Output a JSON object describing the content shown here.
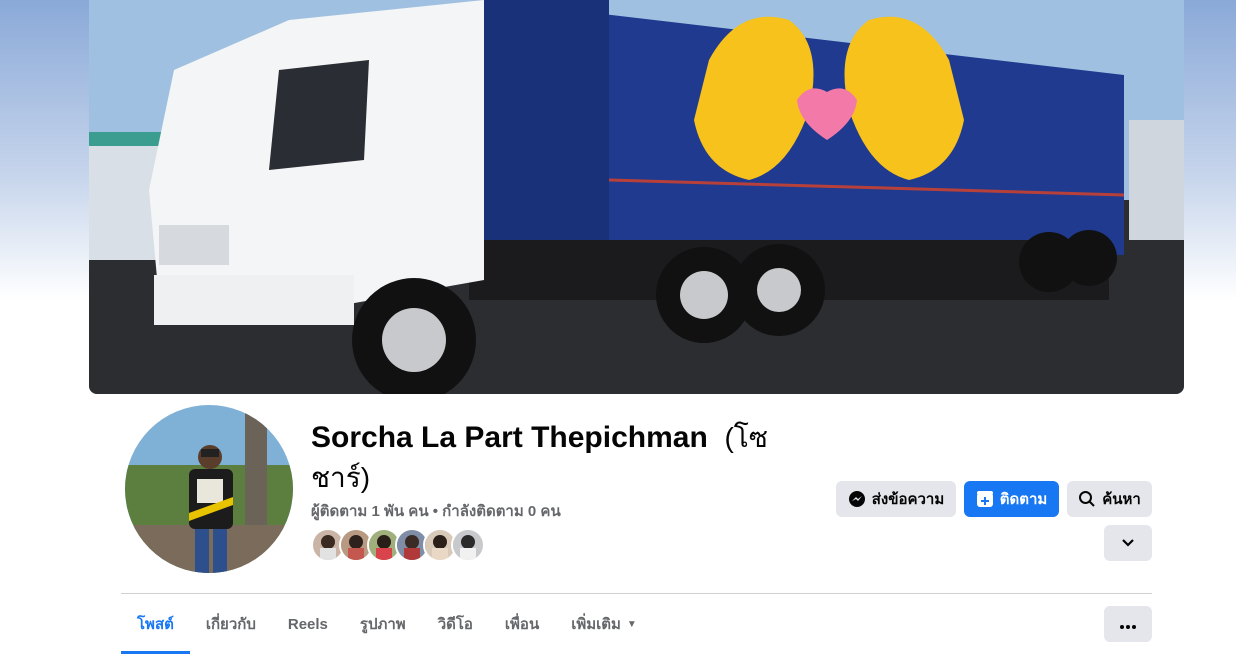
{
  "profile": {
    "name": "Sorcha La Part Thepichman",
    "alt_name": "(โซชาร์)",
    "stats": "ผู้ติดตาม 1 พัน คน • กำลังติดตาม 0 คน"
  },
  "actions": {
    "message": "ส่งข้อความ",
    "follow": "ติดตาม",
    "search": "ค้นหา"
  },
  "tabs": [
    {
      "label": "โพสต์",
      "active": true
    },
    {
      "label": "เกี่ยวกับ"
    },
    {
      "label": "Reels"
    },
    {
      "label": "รูปภาพ"
    },
    {
      "label": "วิดีโอ"
    },
    {
      "label": "เพื่อน"
    },
    {
      "label": "เพิ่มเติม"
    }
  ],
  "colors": {
    "accent": "#1877f2",
    "secondary_text": "#65676b",
    "button_gray": "#e4e6eb"
  }
}
